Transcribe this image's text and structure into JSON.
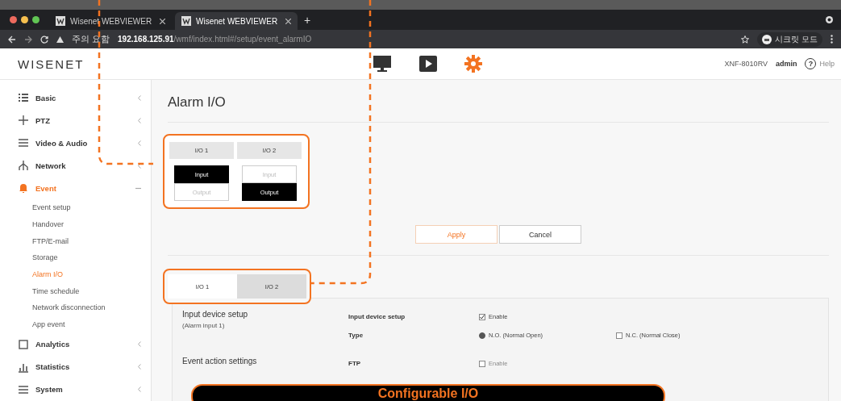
{
  "browser": {
    "tabs": [
      {
        "title": "Wisenet WEBVIEWER",
        "selected": false
      },
      {
        "title": "Wisenet WEBVIEWER",
        "selected": true
      }
    ],
    "new_tab": "+",
    "warning": "주의 요함",
    "url_host": "192.168.125.91",
    "url_path": "/wmf/index.html#/setup/event_alarmIO",
    "profile": "시크릿 모드"
  },
  "header": {
    "logo": "WISENET",
    "nav": [
      {
        "kind": "monitor",
        "selected": false
      },
      {
        "kind": "play",
        "selected": false
      },
      {
        "kind": "gear",
        "selected": true
      }
    ],
    "model": "XNF-8010RV",
    "user": "admin",
    "help": "Help",
    "help_icon": "?"
  },
  "sidebar": {
    "items": [
      {
        "label": "Basic",
        "kind": "list",
        "expanded": false,
        "selected": false
      },
      {
        "label": "PTZ",
        "kind": "cross",
        "expanded": false,
        "selected": false
      },
      {
        "label": "Video & Audio",
        "kind": "lines",
        "expanded": false,
        "selected": false
      },
      {
        "label": "Network",
        "kind": "network",
        "expanded": false,
        "selected": false
      },
      {
        "label": "Event",
        "kind": "bell",
        "expanded": true,
        "selected": true,
        "children": [
          {
            "label": "Event setup",
            "selected": false
          },
          {
            "label": "Handover",
            "selected": false
          },
          {
            "label": "FTP/E-mail",
            "selected": false
          },
          {
            "label": "Storage",
            "selected": false
          },
          {
            "label": "Alarm I/O",
            "selected": true
          },
          {
            "label": "Time schedule",
            "selected": false
          },
          {
            "label": "Network disconnection",
            "selected": false
          },
          {
            "label": "App event",
            "selected": false
          }
        ]
      },
      {
        "label": "Analytics",
        "kind": "square",
        "expanded": false,
        "selected": false
      },
      {
        "label": "Statistics",
        "kind": "bars",
        "expanded": false,
        "selected": false
      },
      {
        "label": "System",
        "kind": "lines",
        "expanded": false,
        "selected": false
      }
    ]
  },
  "page": {
    "title": "Alarm I/O",
    "io_modes": [
      {
        "label": "I/O 1",
        "options": [
          {
            "label": "Input",
            "selected": true
          },
          {
            "label": "Output",
            "selected": false
          }
        ]
      },
      {
        "label": "I/O 2",
        "options": [
          {
            "label": "Input",
            "selected": false
          },
          {
            "label": "Output",
            "selected": true
          }
        ]
      }
    ],
    "buttons": [
      "Apply",
      "Cancel"
    ],
    "io_tabs": [
      {
        "label": "I/O 1",
        "selected": true
      },
      {
        "label": "I/O 2",
        "selected": false
      }
    ],
    "sections": [
      {
        "title": "Input device setup",
        "subtitle": "(Alarm input 1)",
        "rows": [
          {
            "label": "Input device setup",
            "kind": "checkbox",
            "options": [
              {
                "label": "Enable",
                "checked": true
              }
            ]
          },
          {
            "label": "Type",
            "kind": "radio",
            "options": [
              {
                "label": "N.O. (Normal Open)",
                "checked": true
              },
              {
                "label": "N.C. (Normal Close)",
                "checked": false
              }
            ]
          }
        ]
      },
      {
        "title": "Event action settings",
        "rows": [
          {
            "label": "FTP",
            "kind": "checkbox",
            "options": [
              {
                "label": "Enable",
                "checked": false
              }
            ]
          }
        ]
      }
    ]
  },
  "caption": "Configurable I/O"
}
